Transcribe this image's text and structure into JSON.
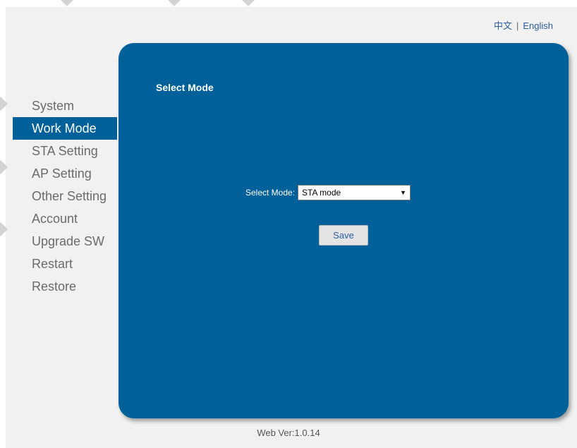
{
  "header": {
    "lang_chinese": "中文",
    "separator": "|",
    "lang_english": "English"
  },
  "sidebar": {
    "items": [
      {
        "label": "System"
      },
      {
        "label": "Work Mode"
      },
      {
        "label": "STA Setting"
      },
      {
        "label": "AP Setting"
      },
      {
        "label": "Other Setting"
      },
      {
        "label": "Account"
      },
      {
        "label": "Upgrade SW"
      },
      {
        "label": "Restart"
      },
      {
        "label": "Restore"
      }
    ],
    "active_index": 1
  },
  "panel": {
    "title": "Select Mode",
    "mode_label": "Select Mode:",
    "mode_value": "STA mode",
    "save_label": "Save"
  },
  "footer": {
    "version": "Web Ver:1.0.14"
  },
  "colors": {
    "accent": "#00609a",
    "background": "#f1f1f1",
    "link": "#2c5f9e"
  }
}
